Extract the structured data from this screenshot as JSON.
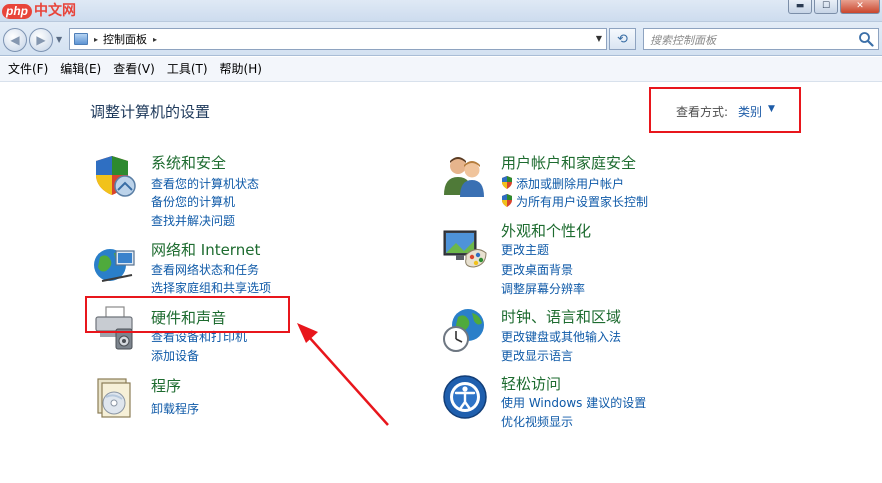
{
  "watermark": {
    "badge": "php",
    "text": "中文网"
  },
  "window_buttons": {
    "minimize": "▬",
    "maximize": "☐",
    "close": "✕"
  },
  "address": {
    "path_item": "控制面板",
    "separator": "▸"
  },
  "search": {
    "placeholder": "搜索控制面板"
  },
  "menu": [
    "文件(F)",
    "编辑(E)",
    "查看(V)",
    "工具(T)",
    "帮助(H)"
  ],
  "page_title": "调整计算机的设置",
  "view": {
    "label": "查看方式:",
    "value": "类别"
  },
  "categories": [
    {
      "title": "系统和安全",
      "links": [
        "查看您的计算机状态",
        "备份您的计算机",
        "查找并解决问题"
      ],
      "icon": "shield-icon"
    },
    {
      "title": "网络和 Internet",
      "links": [
        "查看网络状态和任务",
        "选择家庭组和共享选项"
      ],
      "icon": "network-globe-icon"
    },
    {
      "title": "硬件和声音",
      "links": [
        "查看设备和打印机",
        "添加设备"
      ],
      "icon": "printer-speaker-icon"
    },
    {
      "title": "程序",
      "links": [
        "卸载程序"
      ],
      "icon": "programs-disc-icon"
    },
    {
      "title": "用户帐户和家庭安全",
      "links": [
        "添加或删除用户帐户",
        "为所有用户设置家长控制"
      ],
      "icon": "users-icon"
    },
    {
      "title": "外观和个性化",
      "links": [
        "更改主题",
        "更改桌面背景",
        "调整屏幕分辨率"
      ],
      "icon": "monitor-palette-icon"
    },
    {
      "title": "时钟、语言和区域",
      "links": [
        "更改键盘或其他输入法",
        "更改显示语言"
      ],
      "icon": "clock-globe-icon"
    },
    {
      "title": "轻松访问",
      "links": [
        "使用 Windows 建议的设置",
        "优化视频显示"
      ],
      "icon": "ease-of-access-icon"
    }
  ],
  "colors": {
    "title_green": "#1d6b2f",
    "link_blue": "#0f5aa8",
    "annotation_red": "#e8161c"
  }
}
